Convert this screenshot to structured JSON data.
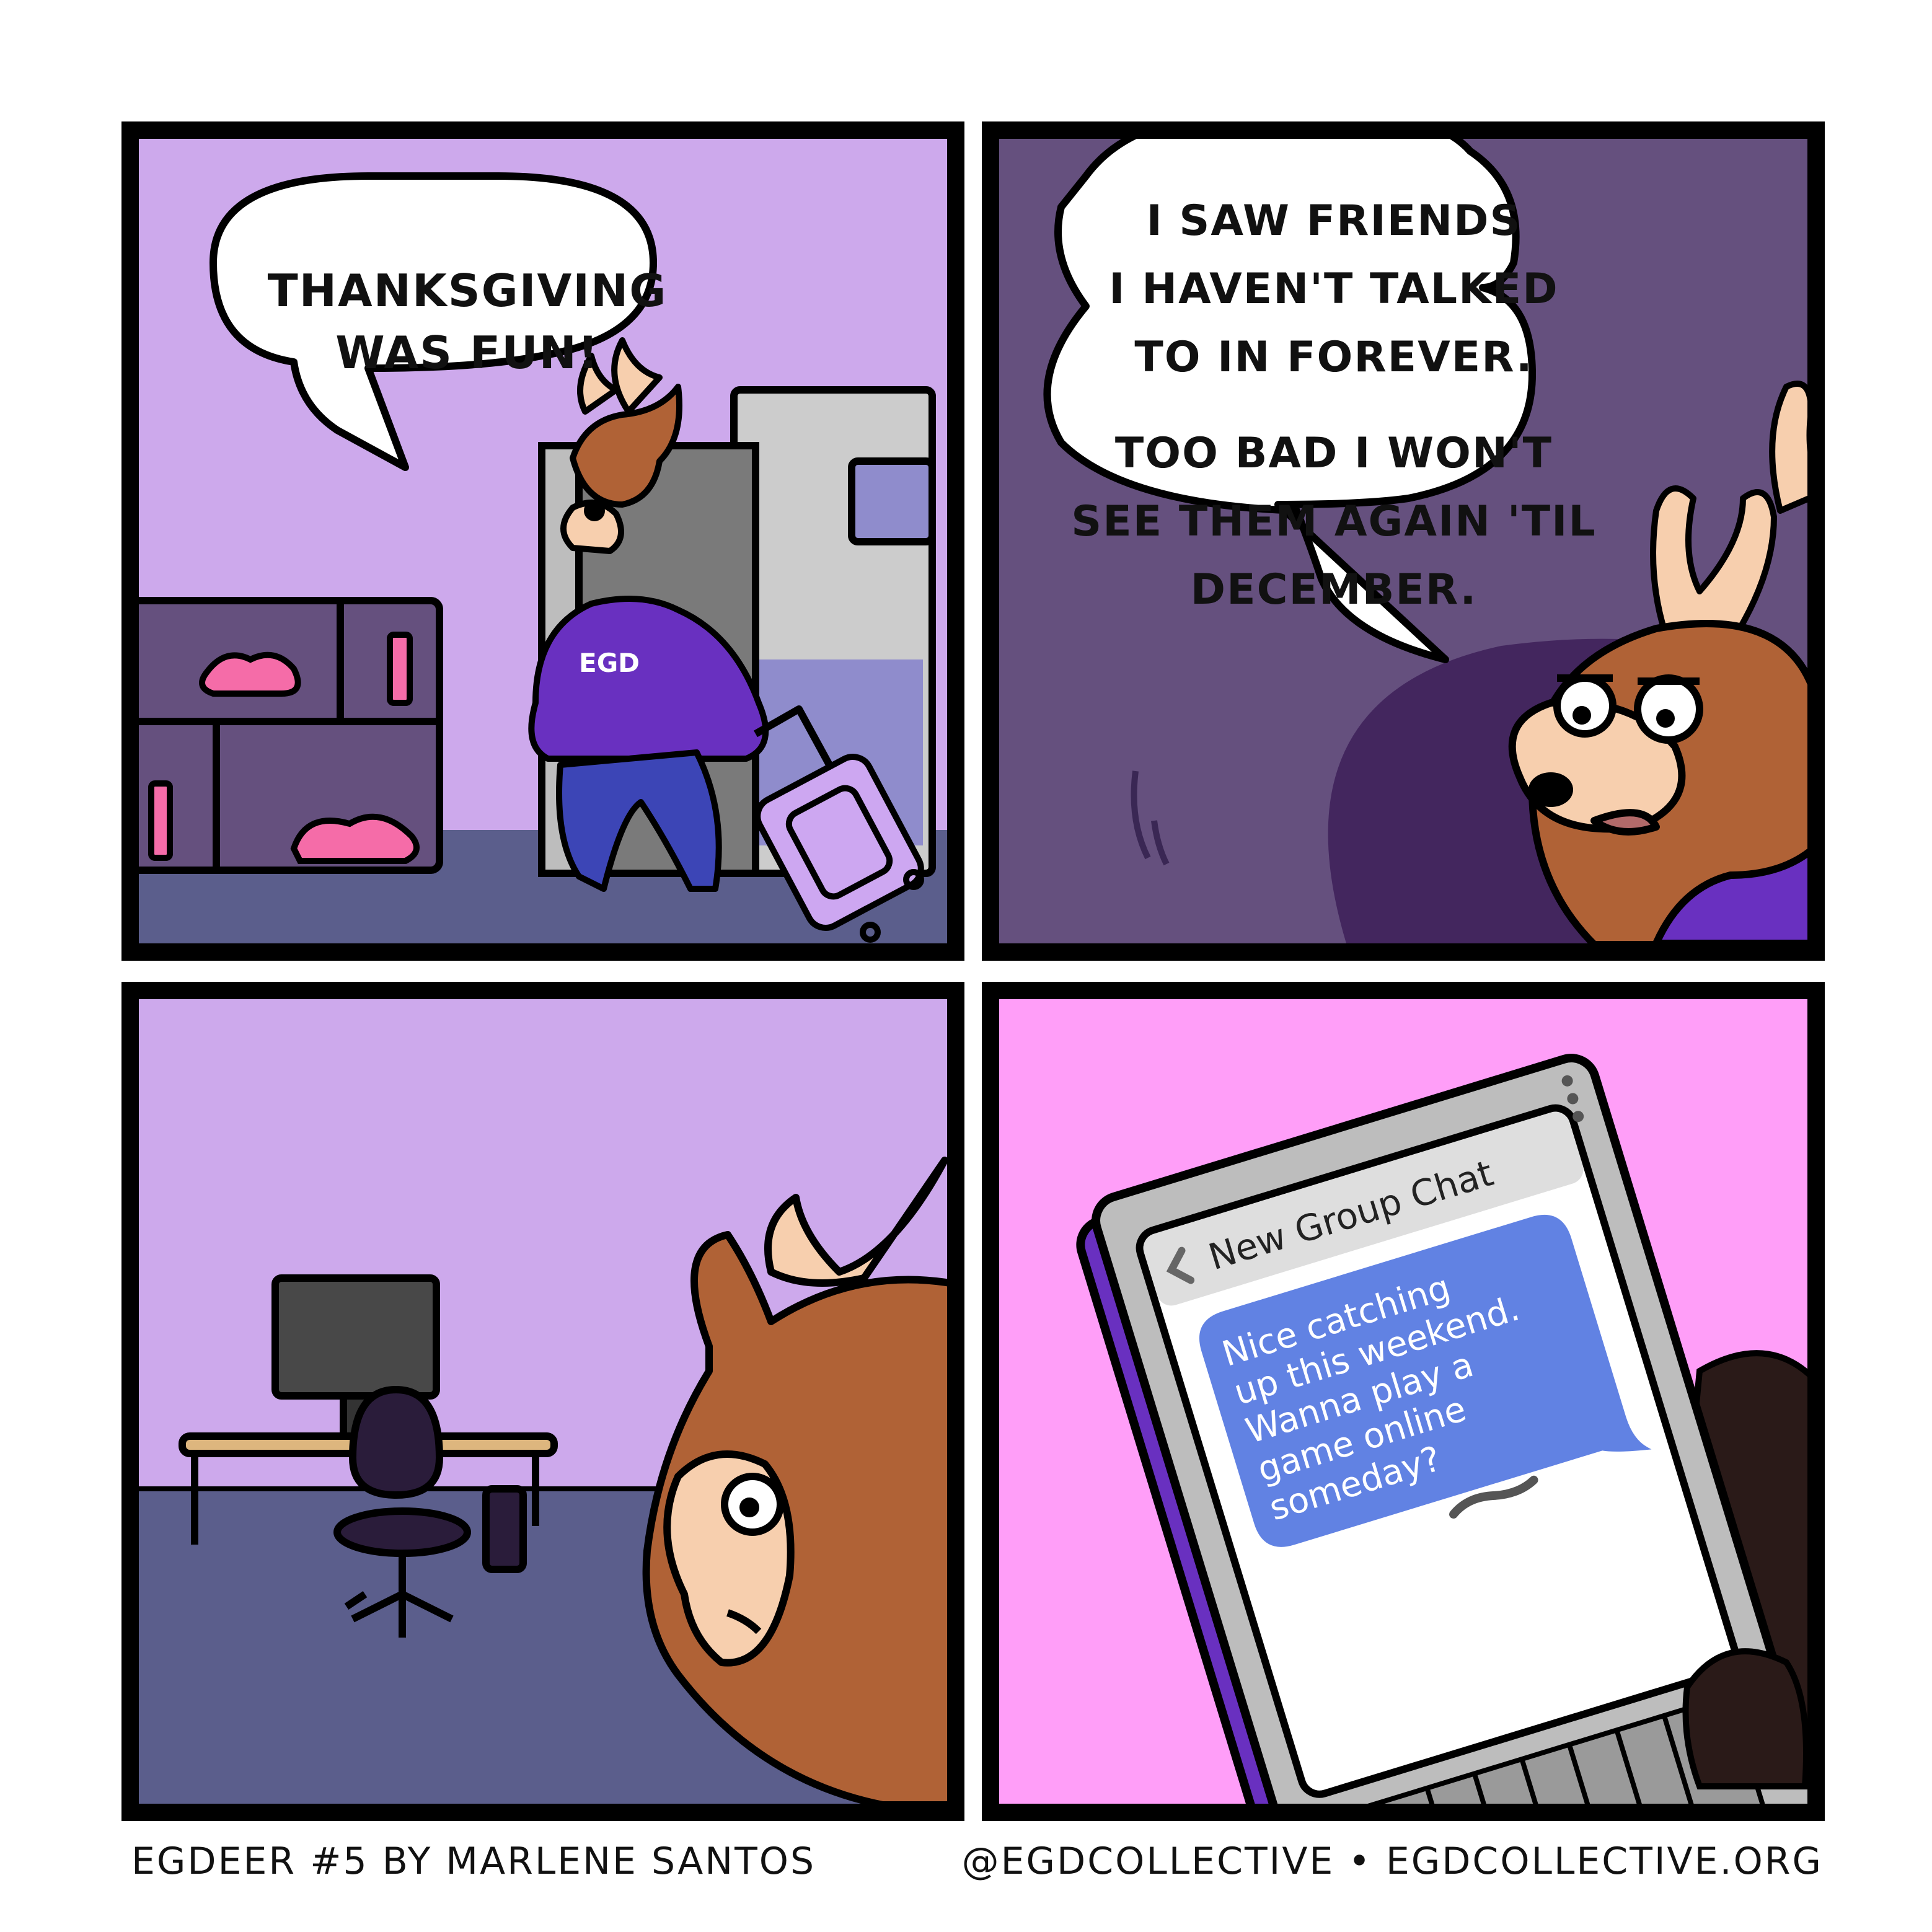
{
  "panel1": {
    "speech": [
      "THANKSGIVING",
      "WAS FUN!"
    ],
    "hoodie_logo": "EGD"
  },
  "panel2": {
    "speech_a": [
      "I SAW FRIENDS",
      "I HAVEN'T TALKED",
      "TO IN FOREVER."
    ],
    "speech_b": [
      "TOO BAD I WON'T",
      "SEE THEM AGAIN 'TIL",
      "DECEMBER."
    ]
  },
  "panel4": {
    "chat_title": "New Group Chat",
    "message_lines": [
      "Nice catching",
      "up this weekend.",
      "Wanna play a",
      "game online",
      "someday?"
    ]
  },
  "footer": {
    "left": "EGDEER #5 BY MARLENE SANTOS",
    "right": "@EGDCOLLECTIVE • EGDCOLLECTIVE.ORG"
  },
  "colors": {
    "wall_light": "#cda9ec",
    "wall_dark": "#65507e",
    "floor": "#5b5e8c",
    "deer": "#b06236",
    "hoodie": "#6930c0",
    "pink_bg": "#ff9ef8",
    "bubble_blue": "#6182e3"
  }
}
